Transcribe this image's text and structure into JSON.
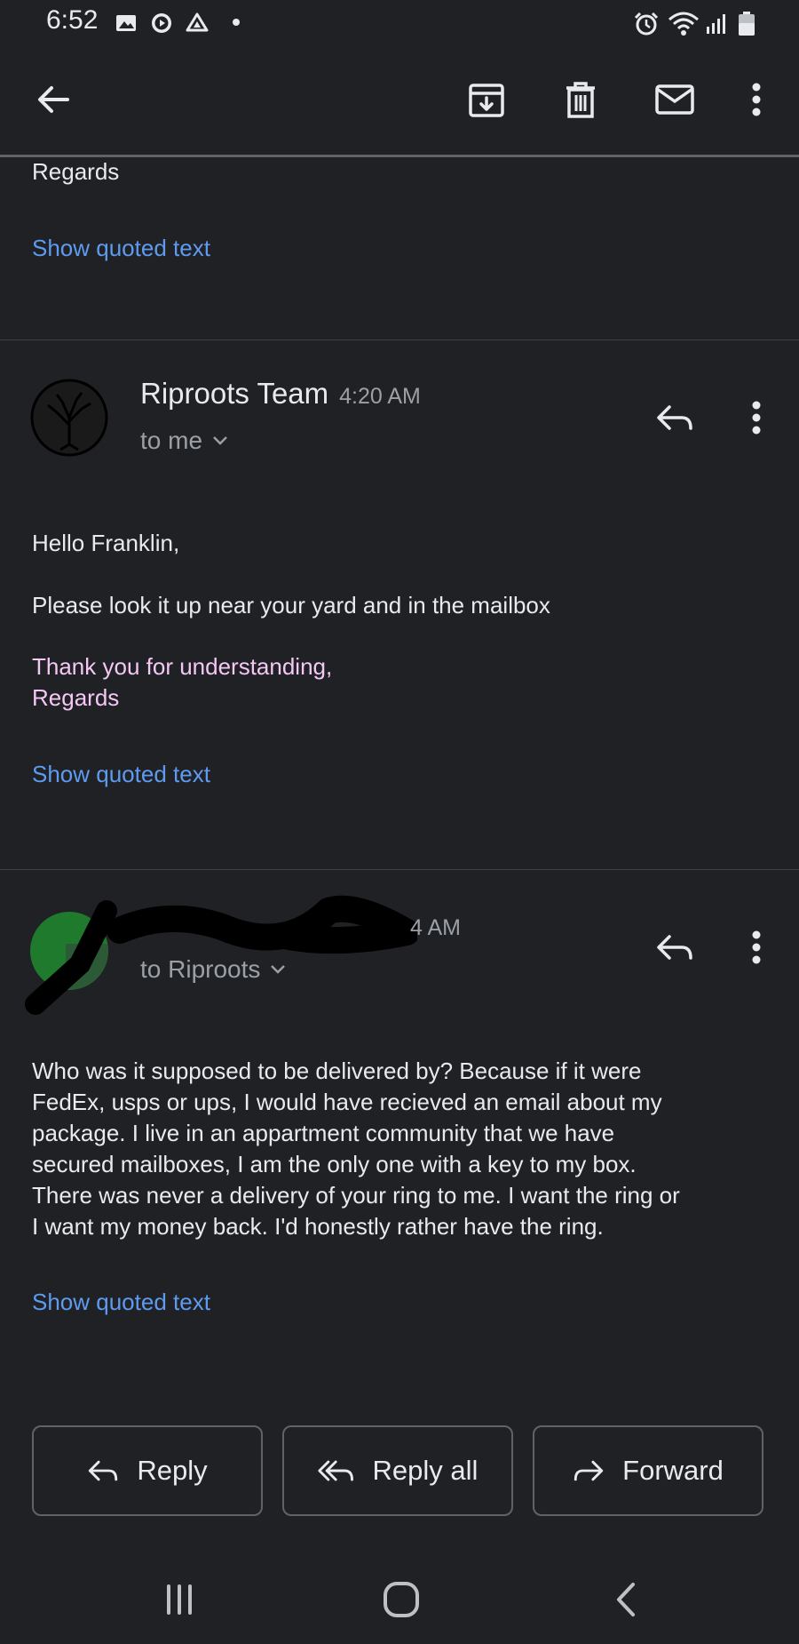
{
  "status_bar": {
    "time": "6:52"
  },
  "message_top": {
    "tail_text": "Regards",
    "show_quoted": "Show quoted text"
  },
  "message_2": {
    "sender": "Riproots Team",
    "time": "4:20 AM",
    "recipient": "to me",
    "greeting": "Hello Franklin,",
    "body": "Please look it up near your yard and in the mailbox",
    "signoff_1": "Thank you for understanding,",
    "signoff_2": "Regards",
    "show_quoted": "Show quoted text"
  },
  "message_3": {
    "time": "4 AM",
    "recipient": "to Riproots",
    "body_lines": [
      "Who was it  supposed to be delivered by? Because if it were",
      "FedEx, usps or ups, I would have recieved an email about my",
      "package. I live in an appartment community that we have",
      "secured mailboxes, I am the only one with a key to my box.",
      "There was never a delivery of your ring to me. I want the ring or",
      "I want my money back. I'd honestly rather have the ring."
    ],
    "show_quoted": "Show quoted text"
  },
  "actions": {
    "reply": "Reply",
    "reply_all": "Reply all",
    "forward": "Forward"
  },
  "colors": {
    "background": "#202124",
    "link": "#5e9bf0",
    "signoff_pink": "#f4c7f5"
  }
}
